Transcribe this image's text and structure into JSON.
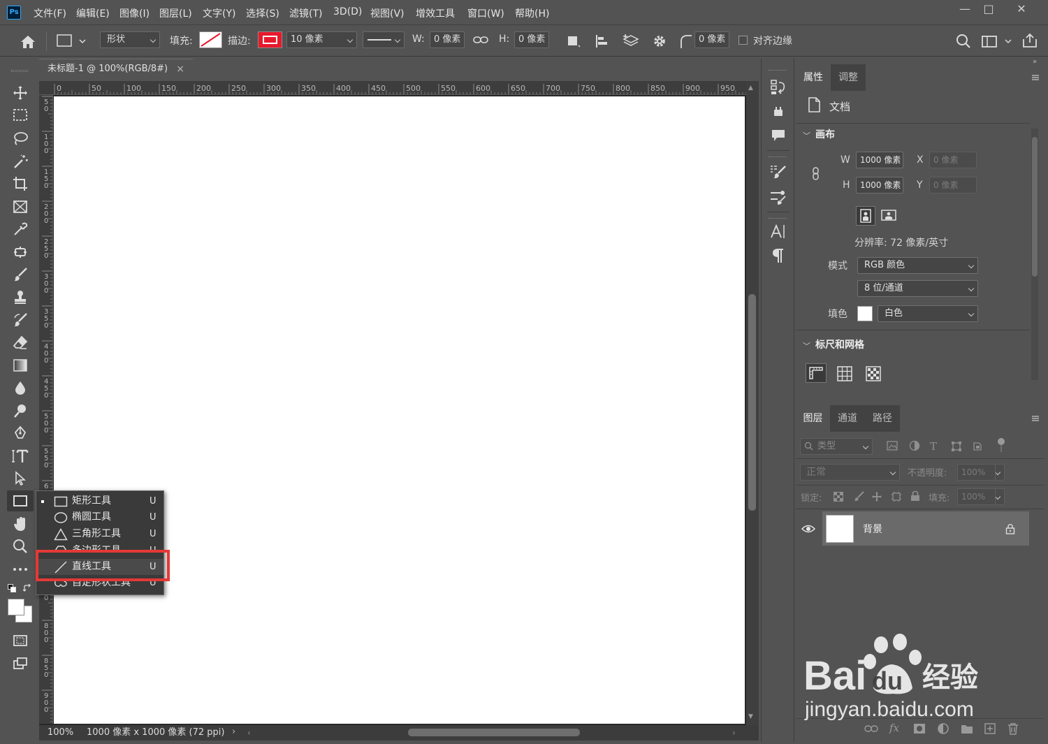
{
  "app": {
    "logo": "Ps"
  },
  "menu": [
    "文件(F)",
    "编辑(E)",
    "图像(I)",
    "图层(L)",
    "文字(Y)",
    "选择(S)",
    "滤镜(T)",
    "3D(D)",
    "视图(V)",
    "增效工具",
    "窗口(W)",
    "帮助(H)"
  ],
  "window_controls": {
    "minimize": "—",
    "maximize": "□",
    "close": "✕"
  },
  "options": {
    "mode": "形状",
    "fill_label": "填充:",
    "stroke_label": "描边:",
    "stroke_width": "10 像素",
    "w_label": "W:",
    "w_value": "0 像素",
    "h_label": "H:",
    "h_value": "0 像素",
    "radius_value": "0 像素",
    "align_edges": "对齐边缘",
    "stroke_color": "#e8192c"
  },
  "document_tab": {
    "title": "未标题-1 @ 100%(RGB/8#)",
    "close": "×"
  },
  "ruler": {
    "h_ticks": [
      "0",
      "50",
      "100",
      "150",
      "200",
      "250",
      "300",
      "350",
      "400",
      "450",
      "500",
      "550",
      "600",
      "650",
      "700",
      "750",
      "800",
      "850",
      "900",
      "950"
    ],
    "v_ticks": [
      "5\n0",
      "1\n0\n0",
      "1\n5\n0",
      "2\n0\n0",
      "2\n5\n0",
      "3\n0\n0",
      "3\n5\n0",
      "4\n0\n0",
      "4\n5\n0",
      "5\n0\n0",
      "5\n5\n0",
      "6",
      "",
      "",
      "5\n0",
      "8\n0\n0",
      "8\n5\n0",
      "9\n0\n0"
    ]
  },
  "flyout": {
    "items": [
      {
        "label": "矩形工具",
        "key": "U",
        "icon": "rectangle-icon",
        "current": true
      },
      {
        "label": "椭圆工具",
        "key": "U",
        "icon": "ellipse-icon",
        "current": false
      },
      {
        "label": "三角形工具",
        "key": "U",
        "icon": "triangle-icon",
        "current": false
      },
      {
        "label": "多边形工具",
        "key": "U",
        "icon": "polygon-icon",
        "current": false
      },
      {
        "label": "直线工具",
        "key": "U",
        "icon": "line-icon",
        "current": false
      },
      {
        "label": "自定形状工具",
        "key": "U",
        "icon": "custom-shape-icon",
        "current": false
      }
    ],
    "highlight_color": "#e53935"
  },
  "status": {
    "zoom": "100%",
    "info": "1000 像素 x 1000 像素 (72 ppi)",
    "arrow": "›"
  },
  "properties": {
    "tabs": [
      "属性",
      "调整"
    ],
    "doc_label": "文档",
    "canvas_section": "画布",
    "w_label": "W",
    "w_value": "1000 像素",
    "h_label": "H",
    "h_value": "1000 像素",
    "x_label": "X",
    "x_value": "0 像素",
    "y_label": "Y",
    "y_value": "0 像素",
    "resolution": "分辨率: 72 像素/英寸",
    "mode_label": "模式",
    "mode_value": "RGB 颜色",
    "depth_value": "8 位/通道",
    "fill_label": "填色",
    "fill_value": "白色",
    "rulers_section": "标尺和网格"
  },
  "layers": {
    "tabs": [
      "图层",
      "通道",
      "路径"
    ],
    "filter_placeholder": "类型",
    "blend_mode": "正常",
    "opacity_label": "不透明度:",
    "opacity_value": "100%",
    "lock_label": "锁定:",
    "fill_label": "填充:",
    "fill_value": "100%",
    "layer_name": "背景"
  },
  "watermark": {
    "brand": "Bai",
    "brand2": "du",
    "suffix": "经验",
    "url": "jingyan.baidu.com"
  }
}
